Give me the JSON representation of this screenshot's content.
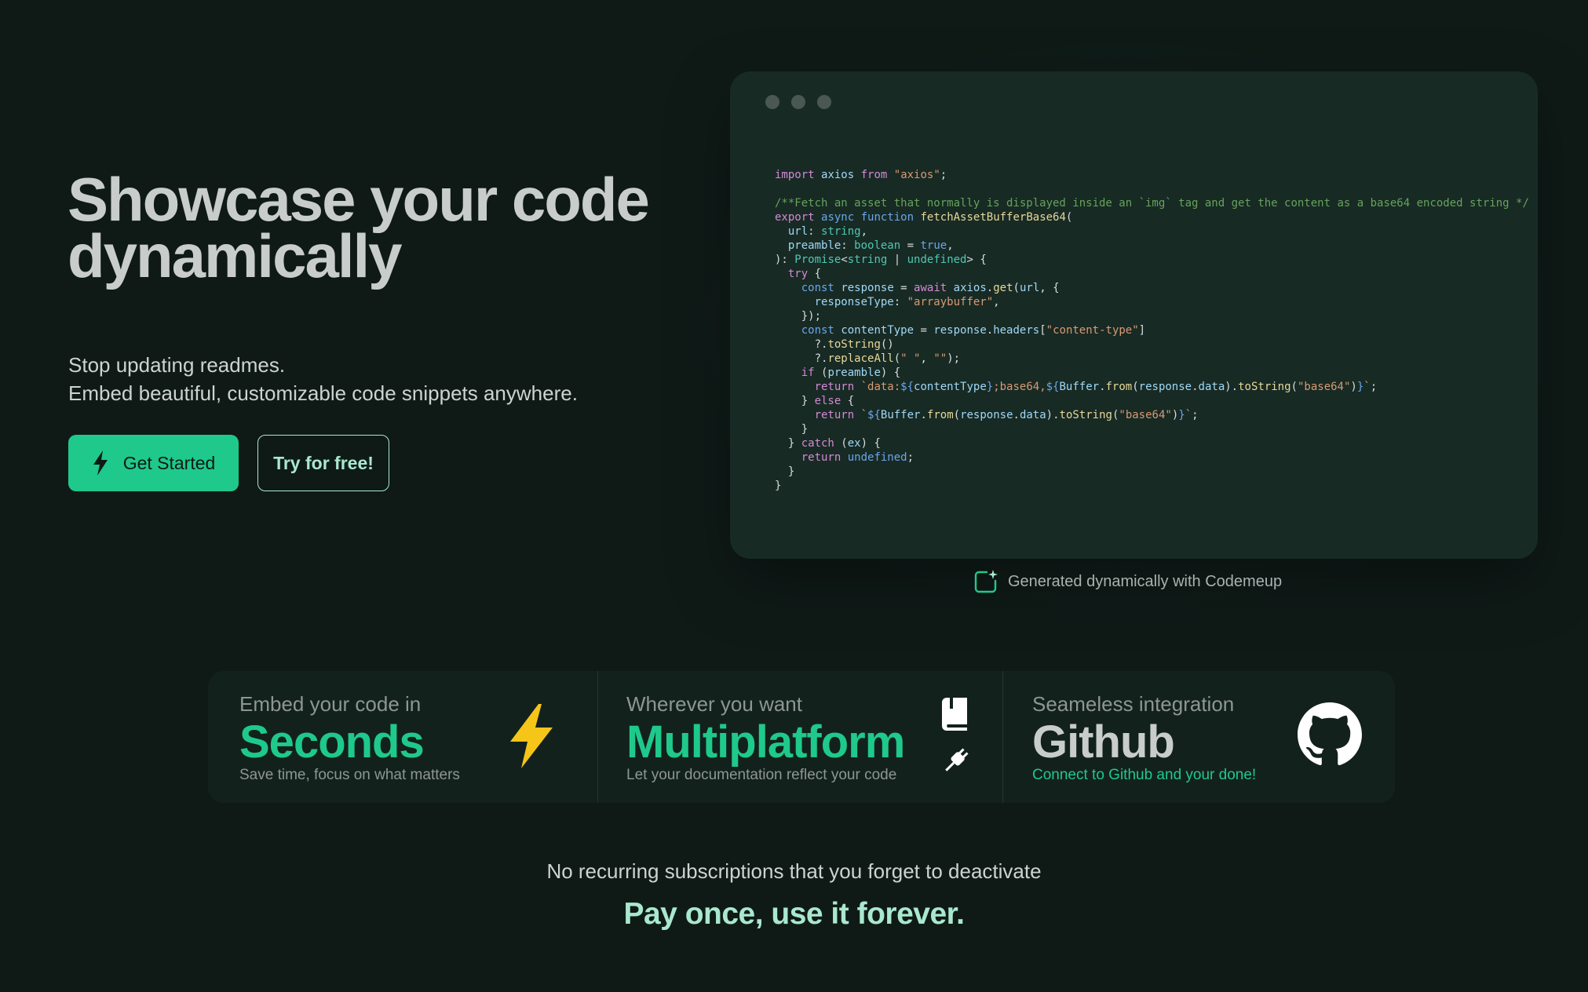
{
  "hero": {
    "title_line1": "Showcase your code",
    "title_line2": "dynamically",
    "subtitle_line1": "Stop updating readmes.",
    "subtitle_line2": "Embed beautiful, customizable code snippets anywhere.",
    "primary_button": "Get Started",
    "secondary_button": "Try for free!"
  },
  "code_window": {
    "caption": "Generated dynamically with Codemeup",
    "lines": [
      [
        [
          "kw",
          "import"
        ],
        [
          "pu",
          " "
        ],
        [
          "vr",
          "axios"
        ],
        [
          "pu",
          " "
        ],
        [
          "kw",
          "from"
        ],
        [
          "pu",
          " "
        ],
        [
          "str",
          "\"axios\""
        ],
        [
          "pu",
          ";"
        ]
      ],
      [],
      [
        [
          "cm",
          "/**Fetch an asset that normally is displayed inside an `img` tag and get the content as a base64 encoded string */"
        ]
      ],
      [
        [
          "kw",
          "export"
        ],
        [
          "pu",
          " "
        ],
        [
          "kb",
          "async"
        ],
        [
          "pu",
          " "
        ],
        [
          "kb",
          "function"
        ],
        [
          "pu",
          " "
        ],
        [
          "fn",
          "fetchAssetBufferBase64"
        ],
        [
          "pu",
          "("
        ]
      ],
      [
        [
          "pu",
          "  "
        ],
        [
          "vr",
          "url"
        ],
        [
          "pu",
          ": "
        ],
        [
          "ty",
          "string"
        ],
        [
          "pu",
          ","
        ]
      ],
      [
        [
          "pu",
          "  "
        ],
        [
          "vr",
          "preamble"
        ],
        [
          "pu",
          ": "
        ],
        [
          "ty",
          "boolean"
        ],
        [
          "pu",
          " = "
        ],
        [
          "kb",
          "true"
        ],
        [
          "pu",
          ","
        ]
      ],
      [
        [
          "pu",
          "): "
        ],
        [
          "ty",
          "Promise"
        ],
        [
          "pu",
          "<"
        ],
        [
          "ty",
          "string"
        ],
        [
          "pu",
          " | "
        ],
        [
          "ty",
          "undefined"
        ],
        [
          "pu",
          "> {"
        ]
      ],
      [
        [
          "pu",
          "  "
        ],
        [
          "kw",
          "try"
        ],
        [
          "pu",
          " {"
        ]
      ],
      [
        [
          "pu",
          "    "
        ],
        [
          "kb",
          "const"
        ],
        [
          "pu",
          " "
        ],
        [
          "vr",
          "response"
        ],
        [
          "pu",
          " = "
        ],
        [
          "kw",
          "await"
        ],
        [
          "pu",
          " "
        ],
        [
          "vr",
          "axios"
        ],
        [
          "pu",
          "."
        ],
        [
          "fn",
          "get"
        ],
        [
          "pu",
          "("
        ],
        [
          "vr",
          "url"
        ],
        [
          "pu",
          ", {"
        ]
      ],
      [
        [
          "pu",
          "      "
        ],
        [
          "vr",
          "responseType"
        ],
        [
          "pu",
          ": "
        ],
        [
          "str",
          "\"arraybuffer\""
        ],
        [
          "pu",
          ","
        ]
      ],
      [
        [
          "pu",
          "    });"
        ]
      ],
      [
        [
          "pu",
          "    "
        ],
        [
          "kb",
          "const"
        ],
        [
          "pu",
          " "
        ],
        [
          "vr",
          "contentType"
        ],
        [
          "pu",
          " = "
        ],
        [
          "vr",
          "response"
        ],
        [
          "pu",
          "."
        ],
        [
          "vr",
          "headers"
        ],
        [
          "pu",
          "["
        ],
        [
          "str",
          "\"content-type\""
        ],
        [
          "pu",
          "]"
        ]
      ],
      [
        [
          "pu",
          "      ?."
        ],
        [
          "fn",
          "toString"
        ],
        [
          "pu",
          "()"
        ]
      ],
      [
        [
          "pu",
          "      ?."
        ],
        [
          "fn",
          "replaceAll"
        ],
        [
          "pu",
          "("
        ],
        [
          "str",
          "\" \""
        ],
        [
          "pu",
          ", "
        ],
        [
          "str",
          "\"\""
        ],
        [
          "pu",
          ");"
        ]
      ],
      [
        [
          "pu",
          "    "
        ],
        [
          "kw",
          "if"
        ],
        [
          "pu",
          " ("
        ],
        [
          "vr",
          "preamble"
        ],
        [
          "pu",
          ") {"
        ]
      ],
      [
        [
          "pu",
          "      "
        ],
        [
          "kw",
          "return"
        ],
        [
          "pu",
          " "
        ],
        [
          "str",
          "`data:"
        ],
        [
          "kb",
          "${"
        ],
        [
          "vr",
          "contentType"
        ],
        [
          "kb",
          "}"
        ],
        [
          "str",
          ";base64,"
        ],
        [
          "kb",
          "${"
        ],
        [
          "vr",
          "Buffer"
        ],
        [
          "pu",
          "."
        ],
        [
          "fn",
          "from"
        ],
        [
          "pu",
          "("
        ],
        [
          "vr",
          "response"
        ],
        [
          "pu",
          "."
        ],
        [
          "vr",
          "data"
        ],
        [
          "pu",
          ")."
        ],
        [
          "fn",
          "toString"
        ],
        [
          "pu",
          "("
        ],
        [
          "str",
          "\"base64\""
        ],
        [
          "pu",
          ")"
        ],
        [
          "kb",
          "}"
        ],
        [
          "str",
          "`"
        ],
        [
          "pu",
          ";"
        ]
      ],
      [
        [
          "pu",
          "    } "
        ],
        [
          "kw",
          "else"
        ],
        [
          "pu",
          " {"
        ]
      ],
      [
        [
          "pu",
          "      "
        ],
        [
          "kw",
          "return"
        ],
        [
          "pu",
          " "
        ],
        [
          "str",
          "`"
        ],
        [
          "kb",
          "${"
        ],
        [
          "vr",
          "Buffer"
        ],
        [
          "pu",
          "."
        ],
        [
          "fn",
          "from"
        ],
        [
          "pu",
          "("
        ],
        [
          "vr",
          "response"
        ],
        [
          "pu",
          "."
        ],
        [
          "vr",
          "data"
        ],
        [
          "pu",
          ")."
        ],
        [
          "fn",
          "toString"
        ],
        [
          "pu",
          "("
        ],
        [
          "str",
          "\"base64\""
        ],
        [
          "pu",
          ")"
        ],
        [
          "kb",
          "}"
        ],
        [
          "str",
          "`"
        ],
        [
          "pu",
          ";"
        ]
      ],
      [
        [
          "pu",
          "    }"
        ]
      ],
      [
        [
          "pu",
          "  } "
        ],
        [
          "kw",
          "catch"
        ],
        [
          "pu",
          " ("
        ],
        [
          "vr",
          "ex"
        ],
        [
          "pu",
          ") {"
        ]
      ],
      [
        [
          "pu",
          "    "
        ],
        [
          "kw",
          "return"
        ],
        [
          "pu",
          " "
        ],
        [
          "kb",
          "undefined"
        ],
        [
          "pu",
          ";"
        ]
      ],
      [
        [
          "pu",
          "  }"
        ]
      ],
      [
        [
          "pu",
          "}"
        ]
      ]
    ]
  },
  "features": [
    {
      "eyebrow": "Embed your code in",
      "big": "Seconds",
      "small": "Save time, focus on what matters",
      "icon": "lightning-icon"
    },
    {
      "eyebrow": "Wherever you want",
      "big": "Multiplatform",
      "small": "Let your documentation reflect your code",
      "icon": "book-icon"
    },
    {
      "eyebrow": "Seameless integration",
      "big": "Github",
      "small": "Connect to Github and your done!",
      "icon": "github-icon"
    }
  ],
  "pricing": {
    "note": "No recurring subscriptions that you forget to deactivate",
    "headline": "Pay once, use it forever."
  },
  "colors": {
    "background": "#0f1a17",
    "accent": "#1fc98b",
    "accent_light": "#a9e8cf",
    "code_bg": "#182a24",
    "lightning": "#f5c518"
  }
}
